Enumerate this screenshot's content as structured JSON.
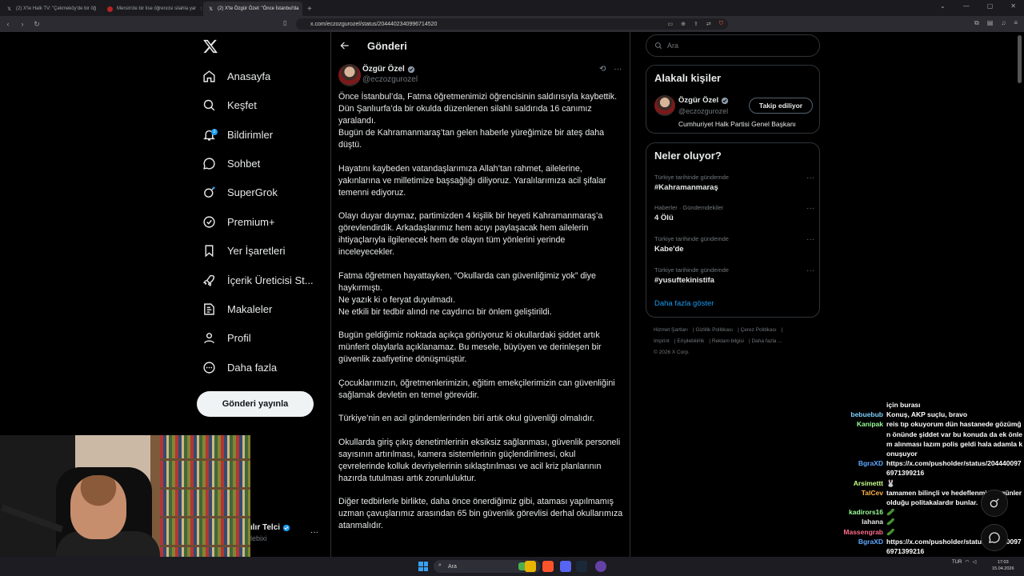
{
  "browser": {
    "tabs": [
      {
        "title": "(2) X'te Halk TV: \"Çekmeköy'de bir öğ",
        "active": false,
        "color": "#333"
      },
      {
        "title": "Mersin'de bir lise öğrencisi silahla yar",
        "active": false,
        "color": "#b22"
      },
      {
        "title": "(2) X'te Özgür Özel: \"Önce İstanbul'da",
        "active": true,
        "color": "#333"
      }
    ],
    "url": "x.com/eczozgurozel/status/2044402340996714520"
  },
  "nav": {
    "items": [
      {
        "label": "Anasayfa",
        "icon": "home-icon"
      },
      {
        "label": "Keşfet",
        "icon": "search-icon"
      },
      {
        "label": "Bildirimler",
        "icon": "bell-icon",
        "badge": "2"
      },
      {
        "label": "Sohbet",
        "icon": "chat-icon"
      },
      {
        "label": "SuperGrok",
        "icon": "grok-icon"
      },
      {
        "label": "Premium+",
        "icon": "premium-icon"
      },
      {
        "label": "Yer İşaretleri",
        "icon": "bookmark-icon"
      },
      {
        "label": "İçerik Üreticisi St...",
        "icon": "rocket-icon"
      },
      {
        "label": "Makaleler",
        "icon": "article-icon"
      },
      {
        "label": "Profil",
        "icon": "person-icon"
      },
      {
        "label": "Daha fazla",
        "icon": "more-circle-icon"
      }
    ],
    "post_button": "Gönderi yayınla"
  },
  "main": {
    "title": "Gönderi",
    "author": {
      "name": "Özgür Özel",
      "handle": "@eczozgurozel"
    },
    "paragraphs": [
      "Önce İstanbul’da, Fatma öğretmenimizi öğrencisinin saldırısıyla kaybettik.\nDün Şanlıurfa’da bir okulda düzenlenen silahlı saldırıda 16 canımız yaralandı.\nBugün de Kahramanmaraş’tan gelen haberle yüreğimize bir ateş daha düştü.",
      "Hayatını kaybeden vatandaşlarımıza Allah’tan rahmet, ailelerine, yakınlarına ve milletimize başsağlığı diliyoruz. Yaralılarımıza acil şifalar temenni ediyoruz.",
      "Olayı duyar duymaz, partimizden 4 kişilik bir heyeti Kahramanmaraş’a görevlendirdik. Arkadaşlarımız hem acıyı paylaşacak hem ailelerin ihtiyaçlarıyla ilgilenecek hem de olayın tüm yönlerini yerinde inceleyecekler.",
      "Fatma öğretmen hayattayken, “Okullarda can güvenliğimiz yok” diye haykırmıştı.\nNe yazık ki o feryat duyulmadı.\nNe etkili bir tedbir alındı ne caydırıcı bir önlem geliştirildi.",
      "Bugün geldiğimiz noktada açıkça görüyoruz ki okullardaki şiddet artık münferit olaylarla açıklanamaz. Bu mesele, büyüyen ve derinleşen bir güvenlik zaafiyetine dönüşmüştür.",
      "Çocuklarımızın, öğretmenlerimizin, eğitim emekçilerimizin can güvenliğini sağlamak devletin en temel görevidir.",
      "Türkiye’nin en acil gündemlerinden biri artık okul güvenliği olmalıdır.",
      "Okullarda giriş çıkış denetimlerinin eksiksiz sağlanması, güvenlik personeli sayısının artırılması, kamera sistemlerinin güçlendirilmesi, okul çevrelerinde kolluk devriyelerinin sıklaştırılması ve acil kriz planlarının hazırda tutulması artık zorunluluktur.",
      "Diğer tedbirlerle birlikte, daha önce önerdiğimiz gibi, ataması yapılmamış uzman çavuşlarımız arasından 65 bin güvenlik görevlisi derhal okullarımıza atanmalıdır."
    ]
  },
  "right": {
    "search_placeholder": "Ara",
    "related": {
      "title": "Alakalı kişiler",
      "name": "Özgür Özel",
      "handle": "@eczozgurozel",
      "bio": "Cumhuriyet Halk Partisi Genel Başkanı",
      "follow_label": "Takip ediliyor"
    },
    "trends": {
      "title": "Neler oluyor?",
      "items": [
        {
          "category": "Türkiye tarihinde gündemde",
          "name": "#Kahramanmaraş"
        },
        {
          "category": "Haberler · Gündemdekiler",
          "name": "4 Ölü"
        },
        {
          "category": "Türkiye tarihinde gündemde",
          "name": "Kabe'de"
        },
        {
          "category": "Türkiye tarihinde gündemde",
          "name": "#yusuftekinistifa"
        }
      ],
      "show_more": "Daha fazla göster"
    },
    "footer": [
      "Hizmet Şartları",
      "Gizlilik Politikası",
      "Çerez Politikası",
      "Imprint",
      "Erişilebilirlik",
      "Reklam bilgisi",
      "Daha fazla ...",
      "© 2026 X Corp."
    ]
  },
  "webcam_overlay": {
    "name": "ılır Telci",
    "handle": "lebixi"
  },
  "chat": [
    {
      "user": "",
      "color": "#fff",
      "msg": "için burası"
    },
    {
      "user": "bebuebub",
      "color": "#7fd1ff",
      "msg": "Konuş, AKP suçlu, bravo"
    },
    {
      "user": "Kanipak",
      "color": "#9aff9a",
      "msg": "reis tıp okuyorum dün hastanede gözümğn önünde şiddet var bu konuda da ek önlem alınması lazım polis geldi hala adamla konuşuyor"
    },
    {
      "user": "BgraXD",
      "color": "#5fa8ff",
      "msg": "https://x.com/pusholder/status/2044400976971399216"
    },
    {
      "user": "Arsimettt",
      "color": "#c6ff8a",
      "msg": "🐰"
    },
    {
      "user": "TalCev",
      "color": "#ffb347",
      "msg": "tamamen bilinçli ve hedeflenmişbu günler olduğu politakalardır bunlar."
    },
    {
      "user": "kadirors16",
      "color": "#9aff9a",
      "msg": "🥒"
    },
    {
      "user": "lahana",
      "color": "#fff",
      "msg": "🥒"
    },
    {
      "user": "Massengrab",
      "color": "#ff6b8a",
      "msg": "🥒"
    },
    {
      "user": "BgraXD",
      "color": "#5fa8ff",
      "msg": "https://x.com/pusholder/status/2044400976971399216"
    }
  ],
  "taskbar": {
    "search": "Ara",
    "lang": "TUR",
    "time": "17:03",
    "date": "15.04.2026"
  }
}
